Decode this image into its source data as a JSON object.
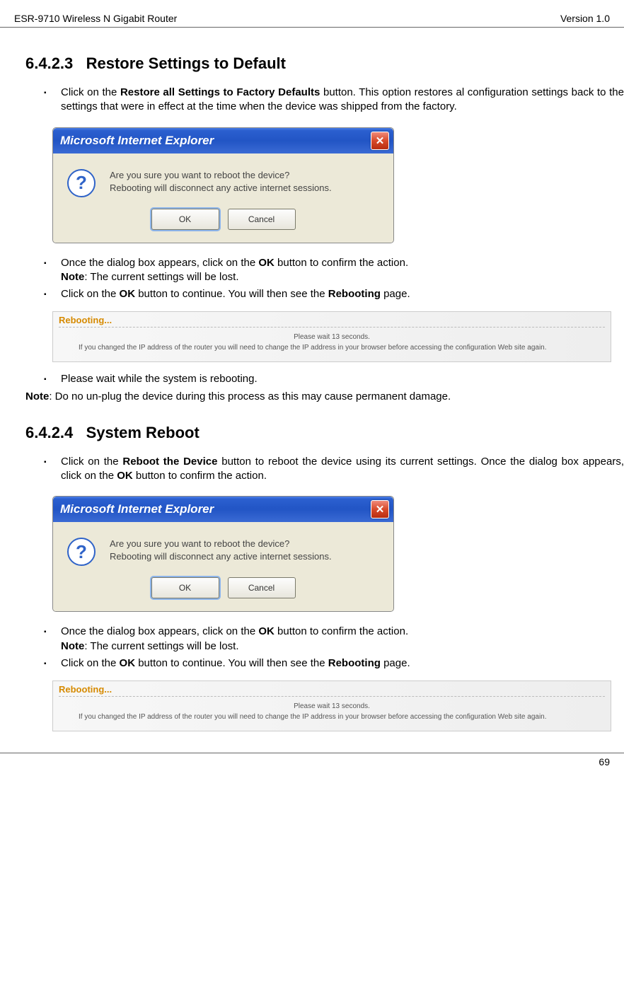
{
  "header": {
    "left": "ESR-9710 Wireless N Gigabit Router",
    "right": "Version 1.0"
  },
  "sections": {
    "restore": {
      "number": "6.4.2.3",
      "title": "Restore Settings to Default",
      "bullets": {
        "b1_pre": "Click on the ",
        "b1_bold": "Restore all Settings to Factory Defaults",
        "b1_post": " button. This option restores al configuration settings back to the settings that were in effect at the time when the device was shipped from the factory.",
        "b2_pre": "Once the dialog box appears, click on the ",
        "b2_bold": "OK",
        "b2_post": " button to confirm the action.",
        "b2_note_label": "Note",
        "b2_note_text": ": The current settings will be lost.",
        "b3_pre": "Click on the ",
        "b3_bold1": "OK",
        "b3_mid": " button to continue.  You will then see the ",
        "b3_bold2": "Rebooting",
        "b3_post": " page.",
        "b4": "Please wait while the system is rebooting.",
        "note_label": "Note",
        "note_text": ":  Do  no  un-plug  the  device  during  this  process  as  this  may  cause  permanent damage."
      }
    },
    "reboot_sec": {
      "number": "6.4.2.4",
      "title": "System Reboot",
      "bullets": {
        "b1_pre": "Click on the ",
        "b1_bold1": "Reboot the Device",
        "b1_mid": " button to reboot the device using its current settings. Once the dialog box appears, click on the ",
        "b1_bold2": "OK",
        "b1_post": " button to confirm the action.",
        "b2_pre": "Once the dialog box appears, click on the ",
        "b2_bold": "OK",
        "b2_post": " button to confirm the action.",
        "b2_note_label": "Note",
        "b2_note_text": ": The current settings will be lost.",
        "b3_pre": "Click on the ",
        "b3_bold1": "OK",
        "b3_mid": " button to continue.  You will then see the ",
        "b3_bold2": "Rebooting",
        "b3_post": " page."
      }
    }
  },
  "dialog": {
    "title": "Microsoft Internet Explorer",
    "msg1": "Are you sure you want to reboot the device?",
    "msg2": "Rebooting will disconnect any active internet sessions.",
    "ok": "OK",
    "cancel": "Cancel"
  },
  "reboot_panel": {
    "title": "Rebooting...",
    "wait": "Please wait 13 seconds.",
    "sub": "If you changed the IP address of the router you will need to change the IP address in your browser before accessing the configuration Web site again."
  },
  "footer": {
    "page": "69"
  }
}
